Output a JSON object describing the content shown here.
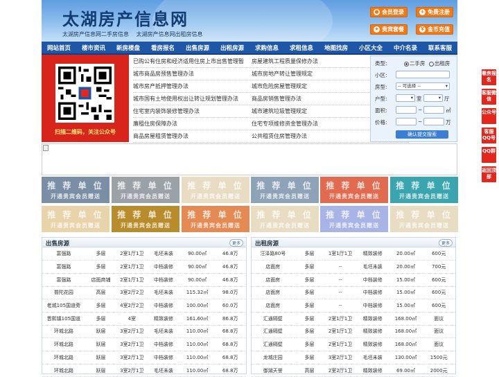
{
  "header": {
    "site_title": "太湖房产信息网",
    "slogans": [
      "太湖房产信息网二手房信息",
      "太湖房产信息网出租房信息"
    ],
    "buttons": [
      {
        "label": "会员登录",
        "icon": "user-icon"
      },
      {
        "label": "免费注册",
        "icon": "register-icon"
      },
      {
        "label": "贵宾套餐",
        "icon": "vip-icon"
      },
      {
        "label": "金币充值",
        "icon": "coin-icon"
      }
    ],
    "brand_color": "#1f57a8",
    "accent_color": "#f07a18"
  },
  "nav": {
    "items": [
      "网站首页",
      "楼市资讯",
      "新房楼盘",
      "看房报名",
      "出售房源",
      "出租房源",
      "求购信息",
      "求租信息",
      "地图找房",
      "小区大全",
      "中介名录",
      "联系客服"
    ]
  },
  "qr": {
    "caption": "扫描二维码，关注公众号"
  },
  "policy_links": {
    "left": [
      "已购公有住房和经济适用住房上市出售管理暂",
      "城市商品房预售管理办法",
      "城市房产抵押管理办法",
      "城市国有土地使用权出让转让规划管理办法",
      "住宅室内装饰装修管理办法",
      "廉租住房保障办法",
      "商品房屋租赁管理办法"
    ],
    "right": [
      "房屋建筑工程质量保修办法",
      "城市房地产转让管理规定",
      "城市危险房屋管理规定",
      "商品房销售管理办法",
      "城市建筑垃圾管理规定",
      "住宅专项维修资金管理办法",
      "公共租赁住房管理办法"
    ]
  },
  "search": {
    "labels": {
      "type": "类型:",
      "community": "小区:",
      "house_type": "房型:",
      "layout": "户型:",
      "area": "面积:",
      "price": "价格:"
    },
    "type_options": [
      "二手房",
      "出租房"
    ],
    "house_type_value": "-- 可选择 --",
    "room_unit": "室",
    "hall_unit": "厅",
    "range_sep": "~",
    "area_unit": "㎡",
    "price_unit": "万",
    "submit_label": "确认提交搜索"
  },
  "recommend": {
    "title": "推 荐 单 位",
    "subtitle": "开通贵宾会员赠送",
    "colors": [
      "#7a8fa6",
      "#9aa2a8",
      "#e8dcc2",
      "#8ea2b8",
      "#e26a4e",
      "#3aa5ae",
      "#e8d3aa",
      "#b88c2a",
      "#e58a52",
      "#e8dcc2",
      "#a8b4e6",
      "#e8dcc2"
    ]
  },
  "sale": {
    "title": "出售房源",
    "more": "更多",
    "rows": [
      [
        "富强路",
        "多层",
        "2室1厅1卫",
        "毛坯未装",
        "90.00㎡",
        "46.8万"
      ],
      [
        "富强路",
        "多层",
        "2室1厅1卫",
        "中档装修",
        "90.00㎡",
        "46.8万"
      ],
      [
        "富强路",
        "店面商铺",
        "2室1厅1卫",
        "中档装修",
        "90.00㎡",
        "46.8万"
      ],
      [
        "普陀花园",
        "高层",
        "3室2厅2卫",
        "毛坯未装",
        "115.32㎡",
        "98.0万"
      ],
      [
        "老城105国道旁",
        "多层",
        "4室2厅2卫",
        "中档装修",
        "100.00㎡",
        "60.0万"
      ],
      [
        "晋熙镇105国道",
        "多层",
        "4室",
        "精致装修",
        "161.60㎡",
        "86.8万"
      ],
      [
        "环城北路",
        "跃层",
        "3室2厅1卫",
        "毛坯未装",
        "110.00㎡",
        "68.8万"
      ],
      [
        "环城北路",
        "跃层",
        "3室2厅1卫",
        "中档装修",
        "110.00㎡",
        "68.8万"
      ],
      [
        "环城北路",
        "跃层",
        "3室2厅1卫",
        "中档装修",
        "110.00㎡",
        "68.8万"
      ],
      [
        "环城北路",
        "跃层",
        "3室2厅1卫",
        "毛坯未装",
        "110.00㎡",
        "68.8万"
      ]
    ]
  },
  "rent": {
    "title": "出租房源",
    "more": "更多",
    "rows": [
      [
        "汪泽路80号",
        "多层",
        "1室1厅1卫",
        "精致装修",
        "20.00㎡",
        "600元"
      ],
      [
        "店面房",
        "多层",
        "--",
        "毛坯未装",
        "20.00㎡",
        "700元"
      ],
      [
        "店面房",
        "多层",
        "--",
        "中档装修",
        "15.00㎡",
        "600元"
      ],
      [
        "店面房",
        "多层",
        "--",
        "中档装修",
        "15.00㎡",
        "600元"
      ],
      [
        "店面房",
        "多层",
        "--",
        "中档装修",
        "15.00㎡",
        "600元"
      ],
      [
        "汇通隔壁",
        "多层",
        "2室1厅1卫",
        "精致装修",
        "168.00㎡",
        "面议"
      ],
      [
        "汇通隔壁",
        "多层",
        "2室1厅1卫",
        "精致装修",
        "168.00㎡",
        "面议"
      ],
      [
        "汇通隔壁",
        "多层",
        "2室1厅1卫",
        "精致装修",
        "168.00㎡",
        "面议"
      ],
      [
        "龙城庄园",
        "多层",
        "3室2厅1卫",
        "毛坯未装",
        "130.00㎡",
        "1500元"
      ],
      [
        "御湖天誉",
        "高层",
        "2室2厅1卫",
        "精致装修",
        "69.00㎡",
        "2000元"
      ]
    ]
  },
  "side_buttons": [
    {
      "label": "看房报名",
      "icon": "signup-icon"
    },
    {
      "label": "客服微信",
      "icon": "wechat-icon"
    },
    {
      "label": "公众号",
      "icon": "official-account-icon"
    },
    {
      "label": "客服QQ号",
      "icon": "qq-icon"
    },
    {
      "label": "QQ群",
      "icon": "qq-group-icon"
    },
    {
      "label": "返回顶部",
      "icon": "back-to-top-icon"
    }
  ]
}
